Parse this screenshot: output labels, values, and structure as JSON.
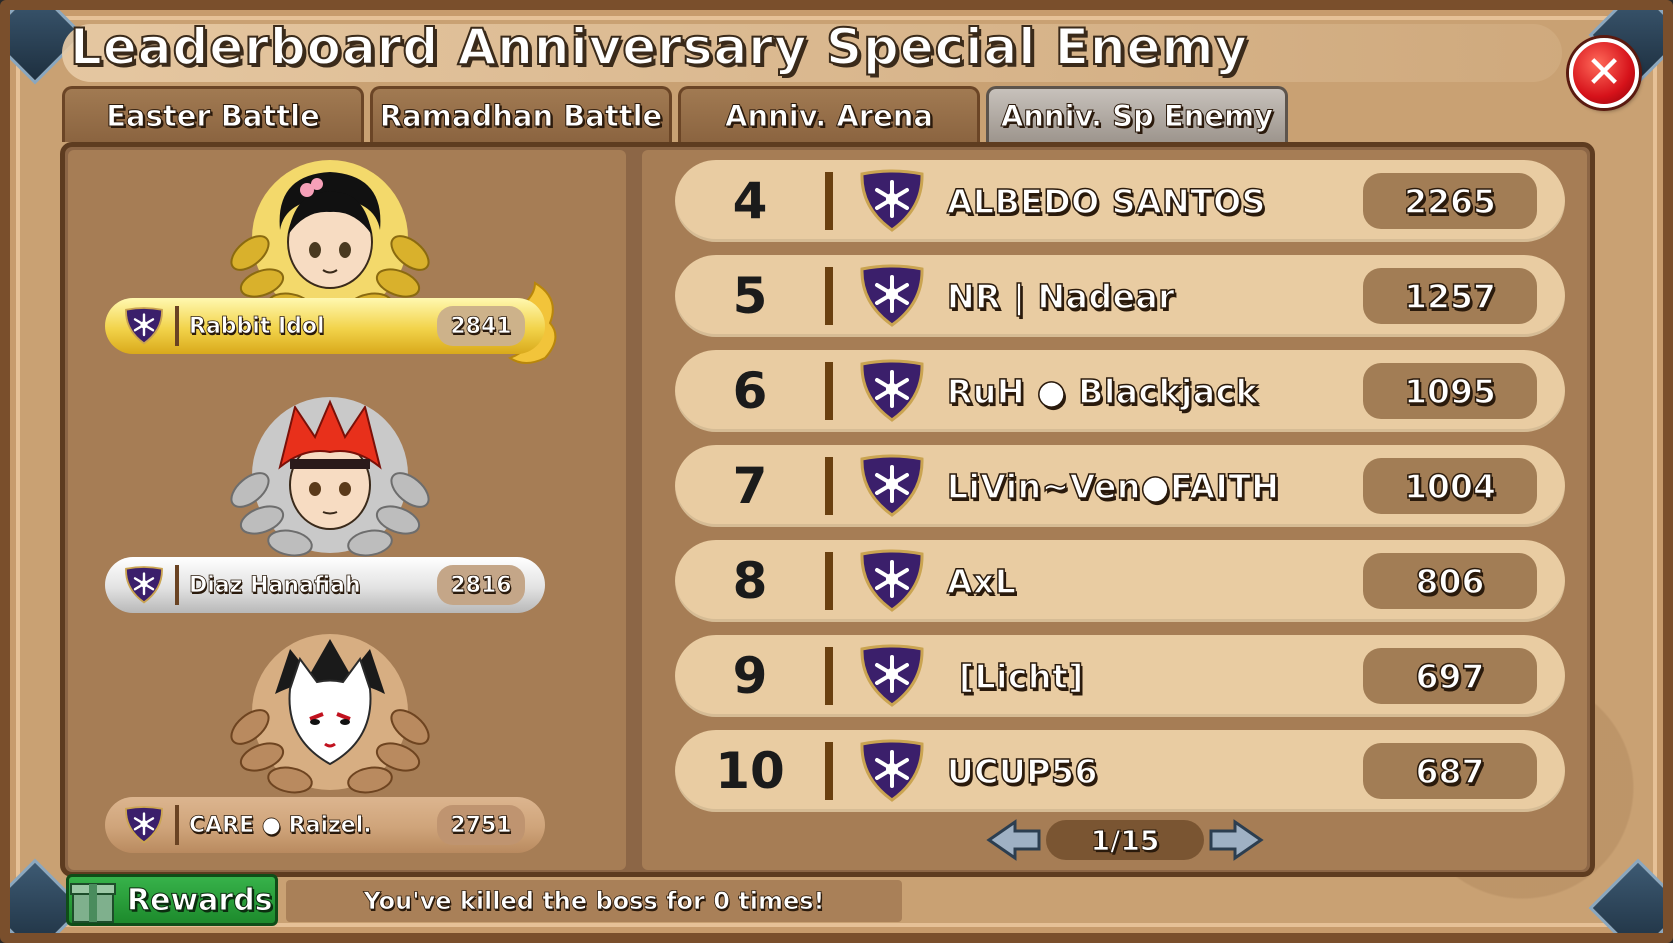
{
  "header": {
    "title": "Leaderboard Anniversary Special Enemy"
  },
  "tabs": [
    {
      "label": "Easter Battle",
      "active": false
    },
    {
      "label": "Ramadhan Battle",
      "active": false
    },
    {
      "label": "Anniv. Arena",
      "active": false
    },
    {
      "label": "Anniv. Sp Enemy",
      "active": true
    }
  ],
  "top3": [
    {
      "name": "Rabbit Idol",
      "score": "2841",
      "medal": "gold"
    },
    {
      "name": "Diaz Hanafiah",
      "score": "2816",
      "medal": "silver"
    },
    {
      "name": "CARE ● Raizel.",
      "score": "2751",
      "medal": "bronze"
    }
  ],
  "rankings": [
    {
      "rank": "4",
      "name": "ALBEDO SANTOS",
      "score": "2265"
    },
    {
      "rank": "5",
      "name": "NR | Nadear",
      "score": "1257"
    },
    {
      "rank": "6",
      "name": "RuH ● Blackjack",
      "score": "1095"
    },
    {
      "rank": "7",
      "name": "LiVin~Ven●FAITH",
      "score": "1004"
    },
    {
      "rank": "8",
      "name": "AxL",
      "score": "806"
    },
    {
      "rank": "9",
      "name": " [Licht]",
      "score": "697"
    },
    {
      "rank": "10",
      "name": "UCUP56",
      "score": "687"
    }
  ],
  "pagination": {
    "label": "1/15",
    "prev_icon": "arrow-left-icon",
    "next_icon": "arrow-right-icon"
  },
  "footer": {
    "rewards_label": "Rewards",
    "status": "You've killed the boss for 0 times!"
  },
  "colors": {
    "clan_shield": "#3b1f6b",
    "gold": "#f2d34a",
    "silver": "#d9d9d9",
    "bronze": "#cfa47a",
    "close": "#d6121a",
    "rewards": "#1d8a2c"
  }
}
